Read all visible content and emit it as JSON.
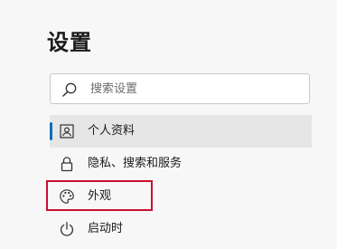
{
  "title": "设置",
  "search": {
    "placeholder": "搜索设置"
  },
  "nav": {
    "items": [
      {
        "label": "个人资料",
        "icon": "profile-icon",
        "selected": true
      },
      {
        "label": "隐私、搜索和服务",
        "icon": "lock-icon",
        "selected": false
      },
      {
        "label": "外观",
        "icon": "palette-icon",
        "selected": false
      },
      {
        "label": "启动时",
        "icon": "power-icon",
        "selected": false
      }
    ]
  },
  "colors": {
    "selection_accent": "#0f6cbd",
    "highlight_border": "#c8102e",
    "selected_background": "#e6e6e6"
  }
}
